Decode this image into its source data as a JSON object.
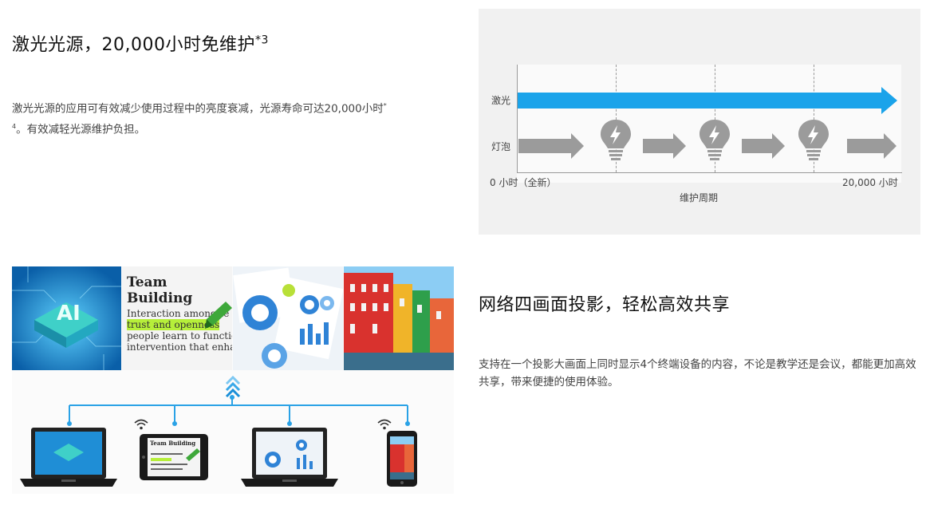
{
  "section1": {
    "title": "激光光源，20,000小时免维护",
    "title_sup": "*3",
    "desc_a": "激光光源的应用可有效减少使用过程中的亮度衰减，光源寿命可达20,000小时",
    "desc_sup_a": "*",
    "desc_sup_b": "4",
    "desc_b": "。有效减轻光源维护负担。"
  },
  "diagram": {
    "laser_label": "激光",
    "lamp_label": "灯泡",
    "x_start": "0 小时（全新）",
    "x_end": "20,000 小时",
    "x_title": "维护周期",
    "colors": {
      "laser": "#1aa3ea",
      "lamp": "#9b9b9b"
    }
  },
  "section2": {
    "title": "网络四画面投影，轻松高效共享",
    "desc": "支持在一个投影大画面上同时显示4个终端设备的内容，不论是教学还是会议，都能更加高效共享，带来便捷的使用体验。"
  },
  "illustration": {
    "doc_title": "Team Building",
    "doc_line1": "Interaction among te",
    "doc_line2_hl": "trust and openness",
    "doc_line3": "people learn to function a",
    "doc_line4": "intervention that enhanc",
    "tablet_title": "Team Building",
    "ai_text": "AI",
    "devices": [
      "laptop",
      "tablet",
      "laptop",
      "phone"
    ],
    "icons": [
      "wifi-icon",
      "up-arrows-icon"
    ]
  }
}
